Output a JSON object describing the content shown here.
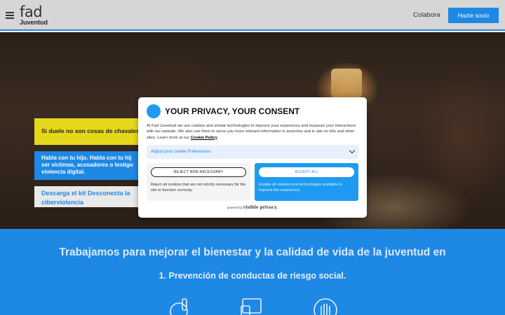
{
  "header": {
    "logo_main": "fad",
    "logo_sub": "Juventud",
    "nav_link": "Colabora",
    "cta": "Hazte socio"
  },
  "hero": {
    "card1": "Si duele no son cosas de chavales.",
    "card2": "Habla con tu hijo. Habla con tu hij ser víctimas, acosadores o testigo violencia digital.",
    "card3": "Descarga el kit Desconecta la ciberviolencia",
    "slides": 3,
    "active_slide": 1
  },
  "section": {
    "title": "Trabajamos para mejorar el bienestar y la calidad de vida de la juventud en",
    "subtitle": "1. Prevención de conductas de riesgo social.",
    "icons": [
      "bottle-icon",
      "devices-icon",
      "hand-stop-icon"
    ]
  },
  "consent": {
    "title": "YOUR PRIVACY, YOUR CONSENT",
    "body": "At Fad Juventud we use cookies and similar technologies to improve your experience and measure your interactions with our website. We also use them to serve you more relevant information in searches and in ads on this and other sites. Learn more at our",
    "policy_link": "Cookie Policy",
    "prefs_label": "Adjust your cookie Preferences",
    "reject_button": "REJECT NON-NECESSARY",
    "reject_text": "Reject all cookies that are not strictly necessary for the site to function correctly.",
    "accept_button": "ACCEPT ALL",
    "accept_text": "Enable all cookies and technologies available to improve the experience.",
    "powered_label": "powered by",
    "powered_brand": "visible privacy."
  }
}
